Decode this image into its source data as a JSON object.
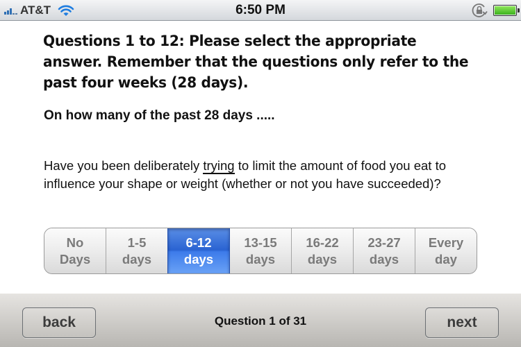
{
  "status_bar": {
    "carrier": "AT&T",
    "time": "6:50 PM",
    "signal_bars_active": 3,
    "signal_bars_total": 5,
    "icons": [
      "signal-icon",
      "wifi-icon",
      "rotation-lock-icon",
      "battery-icon"
    ],
    "battery_level": 1.0
  },
  "content": {
    "heading": "Questions 1 to 12: Please select the appropriate answer. Remember that the questions only refer to the past four weeks (28 days).",
    "subheading": "On how many of the past 28 days .....",
    "question": {
      "before": "Have you been deliberately ",
      "emphasis": "trying",
      "after": " to limit the amount of food you eat to influence your shape or weight (whether or not you have succeeded)?"
    }
  },
  "answers": {
    "selected_index": 2,
    "options": [
      {
        "line1": "No",
        "line2": "Days"
      },
      {
        "line1": "1-5",
        "line2": "days"
      },
      {
        "line1": "6-12",
        "line2": "days"
      },
      {
        "line1": "13-15",
        "line2": "days"
      },
      {
        "line1": "16-22",
        "line2": "days"
      },
      {
        "line1": "23-27",
        "line2": "days"
      },
      {
        "line1": "Every",
        "line2": "day"
      }
    ]
  },
  "toolbar": {
    "back_label": "back",
    "next_label": "next",
    "counter": "Question 1 of 31"
  },
  "colors": {
    "selected_segment": "#2a63d2",
    "battery": "#3cb21f",
    "signal": "#2f6fb4",
    "wifi": "#1f7de0"
  }
}
